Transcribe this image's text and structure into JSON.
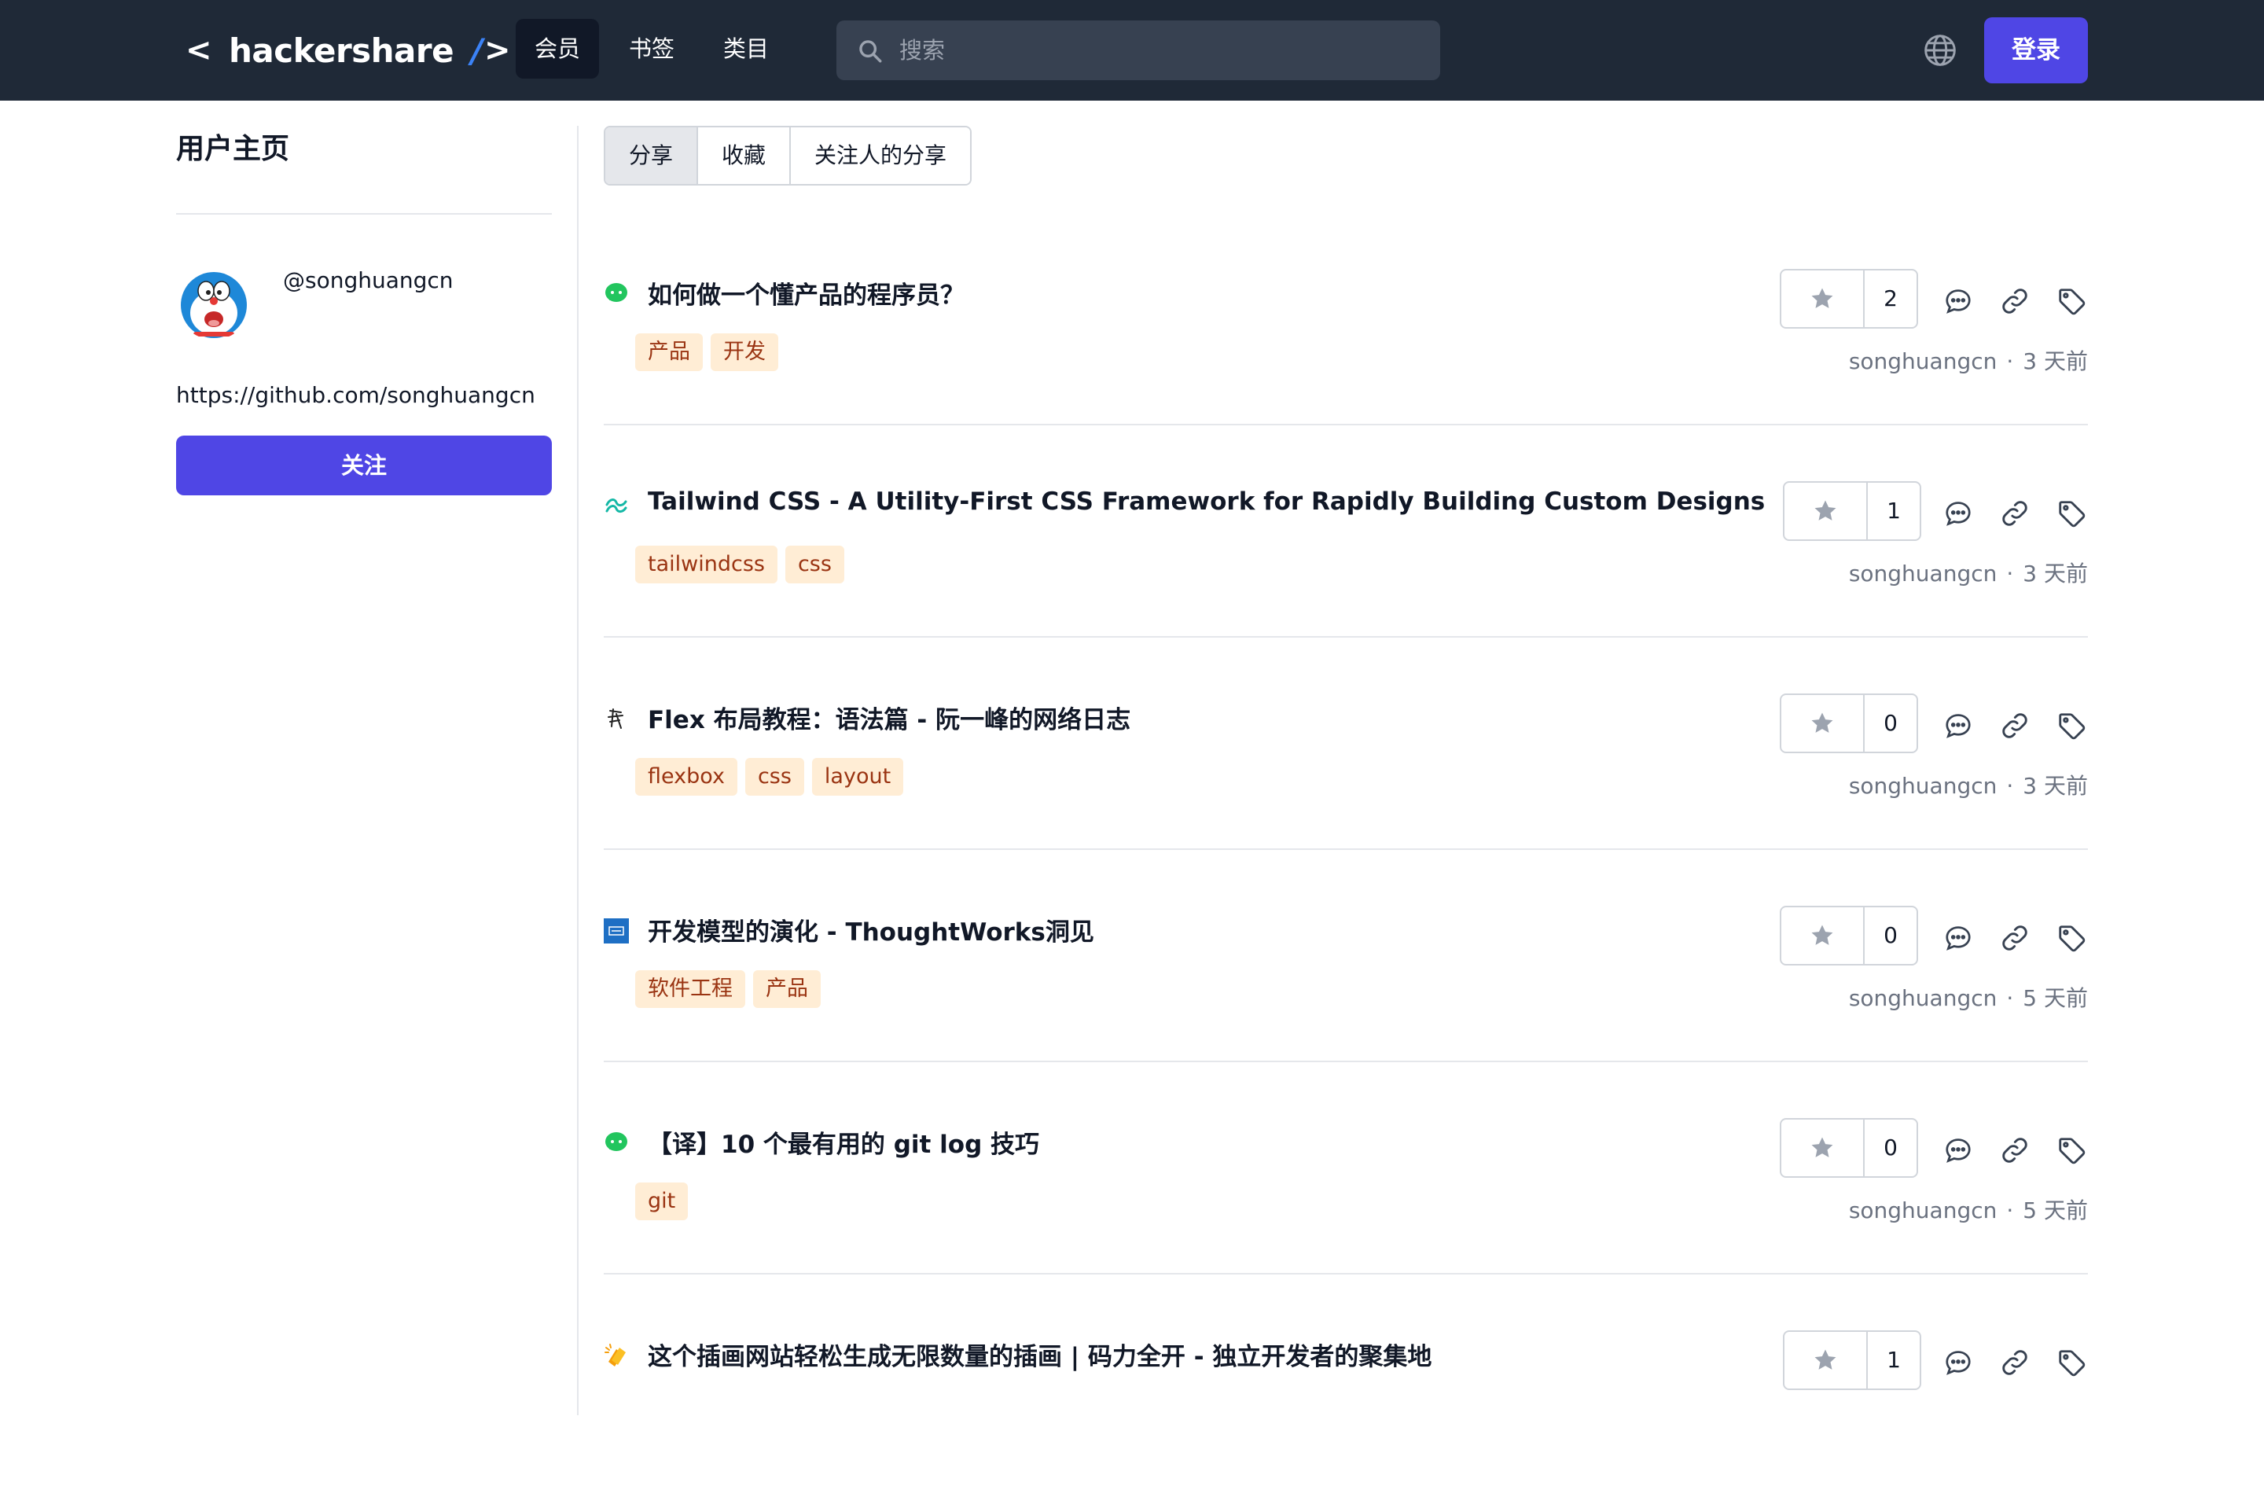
{
  "header": {
    "logo": {
      "open": "<",
      "name": "hackershare",
      "slash": "/",
      "close": ">"
    },
    "nav": [
      {
        "label": "会员",
        "active": true
      },
      {
        "label": "书签",
        "active": false
      },
      {
        "label": "类目",
        "active": false
      }
    ],
    "search": {
      "placeholder": "搜索",
      "value": ""
    },
    "login_label": "登录"
  },
  "sidebar": {
    "title": "用户主页",
    "handle": "@songhuangcn",
    "url": "https://github.com/songhuangcn",
    "follow_label": "关注"
  },
  "tabs": [
    {
      "label": "分享",
      "active": true
    },
    {
      "label": "收藏",
      "active": false
    },
    {
      "label": "关注人的分享",
      "active": false
    }
  ],
  "posts": [
    {
      "favicon": "wechat-icon",
      "title": "如何做一个懂产品的程序员？",
      "tags": [
        "产品",
        "开发"
      ],
      "stars": "2",
      "author": "songhuangcn",
      "time": "3 天前"
    },
    {
      "favicon": "tailwind-icon",
      "title": "Tailwind CSS - A Utility-First CSS Framework for Rapidly Building Custom Designs",
      "tags": [
        "tailwindcss",
        "css"
      ],
      "stars": "1",
      "author": "songhuangcn",
      "time": "3 天前"
    },
    {
      "favicon": "ruanyifeng-icon",
      "title": "Flex 布局教程：语法篇 - 阮一峰的网络日志",
      "tags": [
        "flexbox",
        "css",
        "layout"
      ],
      "stars": "0",
      "author": "songhuangcn",
      "time": "3 天前"
    },
    {
      "favicon": "thoughtworks-icon",
      "title": "开发模型的演化 - ThoughtWorks洞见",
      "tags": [
        "软件工程",
        "产品"
      ],
      "stars": "0",
      "author": "songhuangcn",
      "time": "5 天前"
    },
    {
      "favicon": "wechat-icon",
      "title": "【译】10 个最有用的 git log 技巧",
      "tags": [
        "git"
      ],
      "stars": "0",
      "author": "songhuangcn",
      "time": "5 天前"
    },
    {
      "favicon": "clap-icon",
      "title": "这个插画网站轻松生成无限数量的插画 | 码力全开 - 独立开发者的聚集地",
      "tags": [],
      "stars": "1",
      "author": "",
      "time": ""
    }
  ],
  "colors": {
    "nav_bg": "#1f2937",
    "brand": "#4f46e5",
    "tag_bg": "#ffedd5",
    "tag_text": "#9a3412"
  }
}
